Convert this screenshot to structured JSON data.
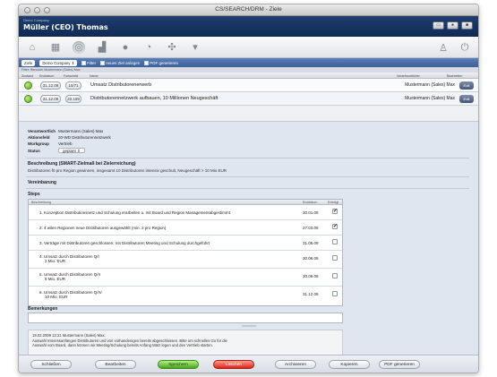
{
  "window": {
    "title": "CS/SEARCH/DRM - Ziele"
  },
  "header": {
    "company": "Demo Company",
    "user": "Müller (CEO) Thomas"
  },
  "filterbar": {
    "tab": "Ziele",
    "company_select": "Demo Company",
    "filter_label": "Filter",
    "new_goal_label": "neues Ziel anlegen",
    "pdf_label": "PDF generieren"
  },
  "infobar": {
    "text": "Filter: Benutzer Mustermann (Sales) Max"
  },
  "columns": {
    "status": "Zustand",
    "date": "Enddatum",
    "progress": "Fortschritt",
    "name": "Name",
    "assignee": "Verantwortlicher",
    "edit": "Bearbeiten"
  },
  "goals": [
    {
      "date": "31.12.09",
      "progress": "10/71",
      "name": "Umsatz Distributorenerwerb",
      "assignee": "Mustermann (Sales) Max",
      "button": "Edit"
    },
    {
      "date": "31.12.09",
      "progress": "20.169",
      "name": "Distributorennetzwerk aufbauen, 10 Millionen Neugeschäft",
      "assignee": "Mustermann (Sales) Max",
      "button": "Edit"
    }
  ],
  "detail": {
    "responsible_label": "Verantwortlich",
    "responsible_value": "Mustermann (Sales) Max",
    "activity_label": "Aktionsfeld",
    "activity_value": "20-WD Distributorennetzwerk",
    "workgroup_label": "Workgroup",
    "workgroup_value": "Vertrieb",
    "status_label": "Status",
    "status_value": "geplant",
    "description_title": "Beschreibung (SMART-Zielmaß bei Zielerreichung)",
    "description_text": "Distributoren f0 pro Region gewinnen, insgesamt 10 Distributoren intensiv geschult, Neugeschäft > 10 Mio EUR",
    "review_title": "Vereinbarung",
    "steps_title": "Steps",
    "steps_head": {
      "desc": "Beschreibung",
      "date": "Enddatum",
      "done": "Erledigt"
    },
    "steps": [
      {
        "text": "1. Konzeption Distributionsnetz und Schulung erarbeiten u. mit Board und Region Managementabgestimmt",
        "date": "30.01.09",
        "done": "✔"
      },
      {
        "text": "2. 4 wilen Regionen neue Distributoren ausgewählt (min. 2 pro Region)",
        "date": "27.03.09",
        "done": "✔"
      },
      {
        "text": "3. Verträge mit Distributoren geschlossen; mit Distributoren Meeting und Schulung durchgeführt",
        "date": "31.05.09",
        "done": ""
      },
      {
        "text": "4. Umsatz durch Distributoren Q/I",
        "text2": "2 Mio. EUR",
        "date": "30.06.09",
        "done": ""
      },
      {
        "text": "5. Umsatz durch Distributoren Q/II",
        "text2": "5 Mio. EUR",
        "date": "30.09.09",
        "done": ""
      },
      {
        "text": "6. Umsatz durch Distributoren Q/IV",
        "text2": "10 Mio. EUR",
        "date": "31.12.09",
        "done": ""
      }
    ],
    "remarks_title": "Bemerkungen",
    "note_line1": "18.02.2009 12:21 Mustermann (Sales) Max:",
    "note_line2": "Auswahl Interessanfängen Distributoren und von vorhandenigen bereits abgeschlossen. Bitte um schnelles Go für die",
    "note_line3": "Auswahl vom Board, dann können wir Meeting/Schulung bereits Anfang März legen und den Vertrieb starten."
  },
  "footer": {
    "close": "Schließen",
    "edit": "Bearbeiten",
    "save": "Speichern",
    "delete": "Löschen",
    "archive": "Archivieren",
    "copy": "Kopieren",
    "pdf": "PDF generieren"
  },
  "colors": {
    "header": "#1f3d6e",
    "filterbar": "#3b5f98",
    "status_green": "#58a41f",
    "save": "#47a61c",
    "delete": "#d82817"
  }
}
